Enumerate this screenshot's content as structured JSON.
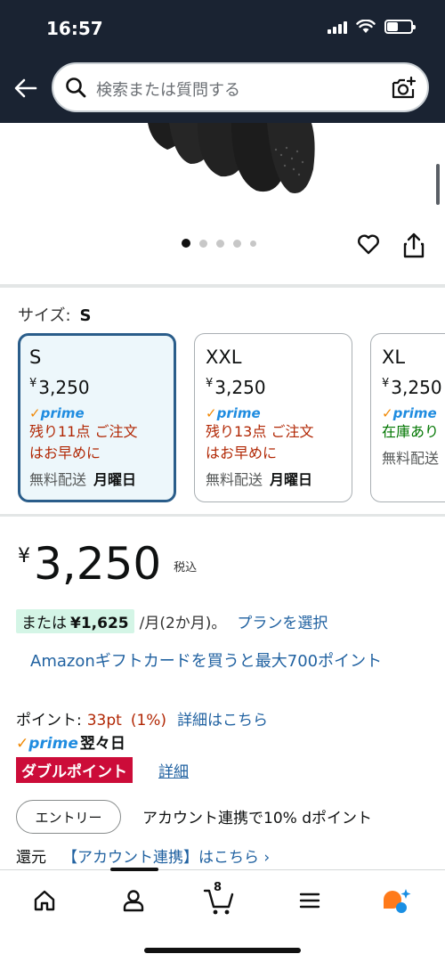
{
  "status_bar": {
    "time": "16:57"
  },
  "search": {
    "placeholder": "検索または質問する"
  },
  "gallery": {
    "dot_count": 5,
    "active_index": 0
  },
  "size_selector": {
    "label": "サイズ:",
    "selected": "S",
    "options": [
      {
        "size": "S",
        "currency": "¥",
        "price": "3,250",
        "prime": "prime",
        "stock_line1": "残り11点 ご注文",
        "stock_line2": "はお早めに",
        "shipping": "無料配送",
        "delivery_day": "月曜日",
        "selected": true
      },
      {
        "size": "XXL",
        "currency": "¥",
        "price": "3,250",
        "prime": "prime",
        "stock_line1": "残り13点 ご注文",
        "stock_line2": "はお早めに",
        "shipping": "無料配送",
        "delivery_day": "月曜日",
        "selected": false
      },
      {
        "size": "XL",
        "currency": "¥",
        "price": "3,250",
        "prime": "prime",
        "stock_line1": "在庫あり",
        "stock_line2": "",
        "shipping": "無料配送",
        "delivery_day": "",
        "selected": false
      }
    ]
  },
  "price": {
    "currency": "¥",
    "amount": "3,250",
    "tax_note": "税込"
  },
  "installment": {
    "prefix": "または",
    "amount": "¥1,625",
    "rest": "/月(2か月)。",
    "link": "プランを選択"
  },
  "gift_card_link": "Amazonギフトカードを買うと最大700ポイント",
  "points": {
    "label": "ポイント:",
    "value": "33pt",
    "percent": "(1%)",
    "link": "詳細はこちら"
  },
  "prime_delivery": {
    "prime": "prime",
    "day": "翌々日"
  },
  "double_point": {
    "badge": "ダブルポイント",
    "link": "詳細"
  },
  "entry": {
    "button": "エントリー",
    "text": "アカウント連携で10% dポイント",
    "return_text": "還元",
    "link": "【アカウント連携】はこちら ›"
  },
  "bottom_nav": {
    "cart_count": "8"
  },
  "colors": {
    "topbar": "#1a2332",
    "link": "#2162a1",
    "price_red": "#b12704",
    "prime_blue": "#1f8ce0",
    "double_badge": "#cc0c39",
    "selected_card_bg": "#edf7fb",
    "installment_bg": "#d4f5e6"
  }
}
